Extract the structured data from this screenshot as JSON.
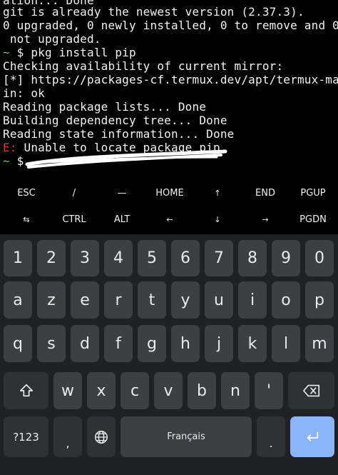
{
  "terminal": {
    "lines": [
      "git is already the newest version (2.37.3).",
      "0 upgraded, 0 newly installed, 0 to remove and 0",
      " not upgraded.",
      "Checking availability of current mirror:",
      "[*] https://packages-cf.termux.dev/apt/termux-ma",
      "in: ok",
      "Reading package lists... Done",
      "Building dependency tree... Done",
      "Reading state information... Done"
    ],
    "top_partial": "ation... Done",
    "prompt_symbol": "~",
    "prompt_sign": "$",
    "cmd_line": " $ pkg install pip",
    "err_prefix": "E:",
    "err_msg": " Unable to locate package pip",
    "last_prompt": " $"
  },
  "extra_keys": {
    "row1": [
      "ESC",
      "/",
      "—",
      "HOME",
      "↑",
      "END",
      "PGUP"
    ],
    "row2": [
      "⇆",
      "CTRL",
      "ALT",
      "←",
      "↓",
      "→",
      "PGDN"
    ]
  },
  "keyboard": {
    "numbers": [
      "1",
      "2",
      "3",
      "4",
      "5",
      "6",
      "7",
      "8",
      "9",
      "0"
    ],
    "row_a": [
      "a",
      "z",
      "e",
      "r",
      "t",
      "y",
      "u",
      "i",
      "o",
      "p"
    ],
    "row_q": [
      "q",
      "s",
      "d",
      "f",
      "g",
      "h",
      "j",
      "k",
      "l",
      "m"
    ],
    "row_w": [
      "w",
      "x",
      "c",
      "v",
      "b",
      "n",
      "'"
    ],
    "sym_label": "?123",
    "comma": ",",
    "space_label": "Français",
    "period": ".",
    "colors": {
      "keyboard_bg": "#202124",
      "key_bg": "#3c4043",
      "enter_bg": "#8ab4f8"
    }
  }
}
